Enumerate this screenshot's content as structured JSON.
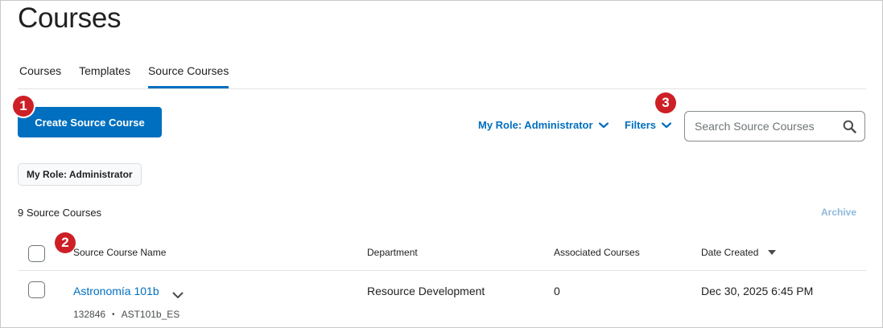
{
  "page": {
    "title": "Courses"
  },
  "tabs": [
    {
      "label": "Courses",
      "active": false
    },
    {
      "label": "Templates",
      "active": false
    },
    {
      "label": "Source Courses",
      "active": true
    }
  ],
  "toolbar": {
    "create_label": "Create Source Course",
    "role_dropdown_label": "My Role: Administrator",
    "filters_label": "Filters"
  },
  "search": {
    "placeholder": "Search Source Courses",
    "value": ""
  },
  "callouts": {
    "one": "1",
    "two": "2",
    "three": "3"
  },
  "applied_filter": {
    "label": "My Role: Administrator"
  },
  "summary": {
    "count_text": "9 Source Courses",
    "archive_label": "Archive"
  },
  "table": {
    "columns": [
      "Source Course Name",
      "Department",
      "Associated Courses",
      "Date Created"
    ],
    "sort_column": "Date Created",
    "rows": [
      {
        "name": "Astronomía 101b",
        "department": "Resource Development",
        "associated": "0",
        "date_created": "Dec 30, 2025 6:45 PM",
        "id": "132846",
        "code": "AST101b_ES"
      }
    ]
  },
  "colors": {
    "accent": "#006fbf",
    "callout": "#cd2026",
    "archive_disabled": "#8fb9dc"
  }
}
